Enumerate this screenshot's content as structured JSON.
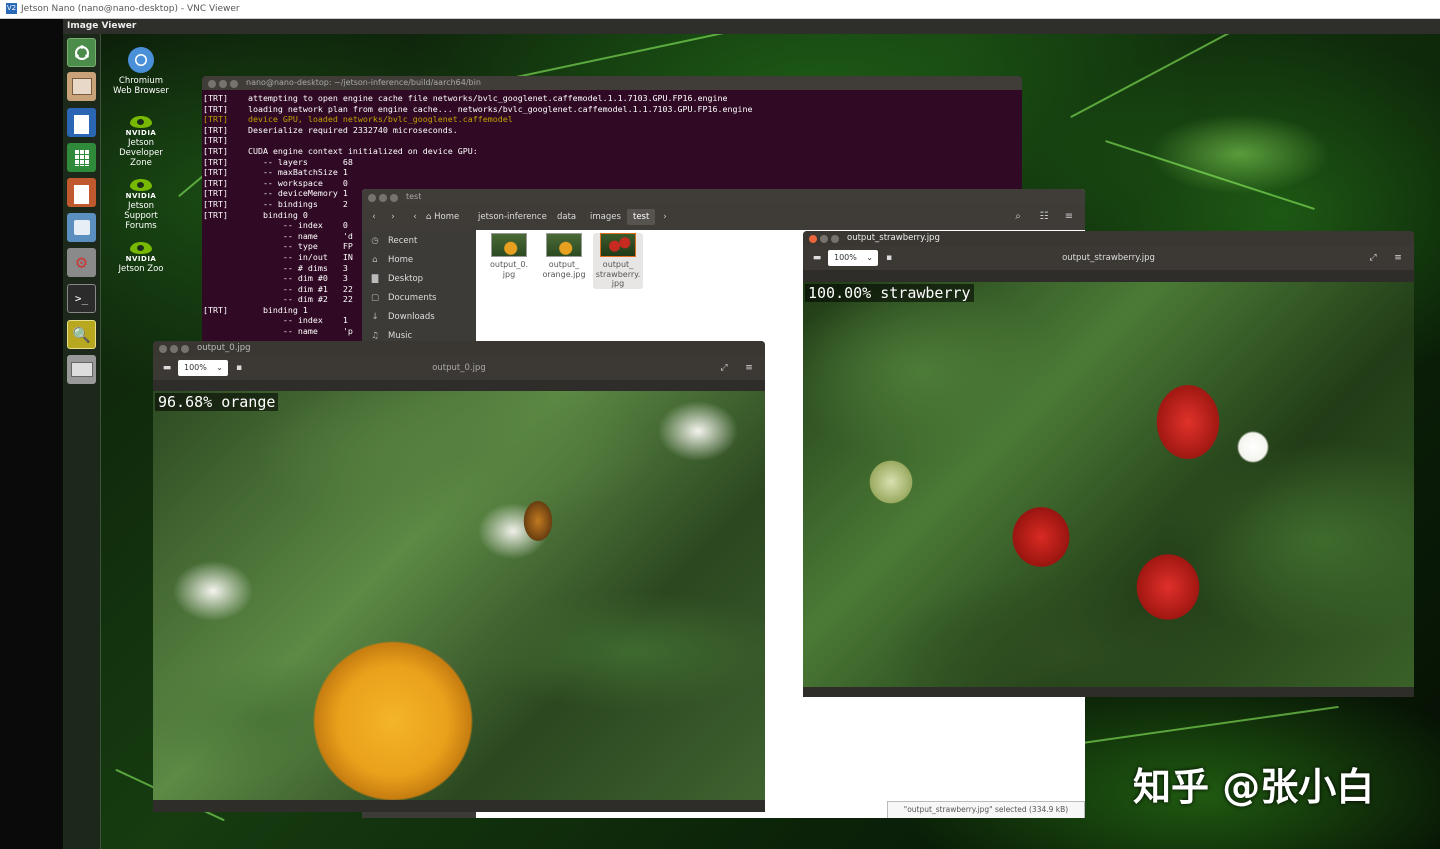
{
  "vnc": {
    "title": "Jetson Nano (nano@nano-desktop) - VNC Viewer"
  },
  "app_title": "Image Viewer",
  "desktop_icons": [
    {
      "label": "Chromium Web Browser"
    },
    {
      "label": "Jetson Developer Zone",
      "brand": "nvidia"
    },
    {
      "label": "Jetson Support Forums",
      "brand": "nvidia"
    },
    {
      "label": "Jetson Zoo",
      "brand": "nvidia"
    }
  ],
  "launcher": [
    "ubuntu-dash-icon",
    "file-cabinet-icon",
    "writer-doc-icon",
    "calc-sheet-icon",
    "impress-slides-icon",
    "software-bag-icon",
    "settings-wrench-icon",
    "terminal-icon",
    "image-viewer-icon",
    "drive-icon"
  ],
  "terminal": {
    "title": "nano@nano-desktop: ~/jetson-inference/build/aarch64/bin",
    "lines": [
      "[TRT]    attempting to open engine cache file networks/bvlc_googlenet.caffemodel.1.1.7103.GPU.FP16.engine",
      "[TRT]    loading network plan from engine cache... networks/bvlc_googlenet.caffemodel.1.1.7103.GPU.FP16.engine",
      "[TRT]    device GPU, loaded networks/bvlc_googlenet.caffemodel",
      "[TRT]    Deserialize required 2332740 microseconds.",
      "[TRT]",
      "[TRT]    CUDA engine context initialized on device GPU:",
      "[TRT]       -- layers       68",
      "[TRT]       -- maxBatchSize 1",
      "[TRT]       -- workspace    0",
      "[TRT]       -- deviceMemory 1",
      "[TRT]       -- bindings     2",
      "[TRT]       binding 0",
      "                -- index    0",
      "                -- name     'd",
      "                -- type     FP",
      "                -- in/out   IN",
      "                -- # dims   3",
      "                -- dim #0   3",
      "                -- dim #1   22",
      "                -- dim #2   22",
      "[TRT]       binding 1",
      "                -- index    1",
      "                -- name     'p"
    ]
  },
  "file_manager": {
    "title": "test",
    "breadcrumb": [
      "Home",
      "jetson-inference",
      "data",
      "images",
      "test"
    ],
    "sidebar": [
      "Recent",
      "Home",
      "Desktop",
      "Documents",
      "Downloads",
      "Music"
    ],
    "sidebar_icons": [
      "clock-icon",
      "home-icon",
      "folder-icon",
      "document-icon",
      "download-icon",
      "music-icon"
    ],
    "files": [
      {
        "name": "output_0.\njpg"
      },
      {
        "name": "output_\norange.jpg"
      },
      {
        "name": "output_\nstrawberry.\njpg"
      }
    ],
    "status": "\"output_strawberry.jpg\" selected  (334.9 kB)"
  },
  "viewer_orange": {
    "window_title": "output_0.jpg",
    "zoom": "100%",
    "filename": "output_0.jpg",
    "overlay": "96.68% orange"
  },
  "viewer_strawberry": {
    "window_title": "output_strawberry.jpg",
    "zoom": "100%",
    "filename": "output_strawberry.jpg",
    "overlay": "100.00% strawberry"
  },
  "watermark": "知乎 @张小白"
}
